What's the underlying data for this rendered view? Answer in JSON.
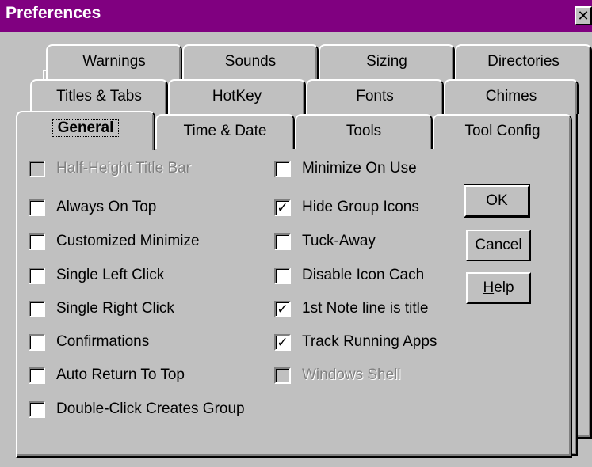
{
  "window": {
    "title": "Preferences",
    "close_glyph": "✕"
  },
  "tabs": {
    "row_back": [
      "Warnings",
      "Sounds",
      "Sizing",
      "Directories"
    ],
    "row_middle": [
      "Titles & Tabs",
      "HotKey",
      "Fonts",
      "Chimes"
    ],
    "row_front": [
      "General",
      "Time & Date",
      "Tools",
      "Tool Config"
    ],
    "active": "General"
  },
  "left_options": [
    {
      "label": "Half-Height Title Bar",
      "checked": false,
      "enabled": false
    },
    {
      "label": "Always On Top",
      "checked": false,
      "enabled": true
    },
    {
      "label": "Customized Minimize",
      "checked": false,
      "enabled": true
    },
    {
      "label": "Single Left Click",
      "checked": false,
      "enabled": true
    },
    {
      "label": "Single Right Click",
      "checked": false,
      "enabled": true
    },
    {
      "label": "Confirmations",
      "checked": false,
      "enabled": true
    },
    {
      "label": "Auto Return To Top",
      "checked": false,
      "enabled": true
    },
    {
      "label": "Double-Click Creates Group",
      "checked": false,
      "enabled": true
    }
  ],
  "right_options": [
    {
      "label": "Minimize On Use",
      "checked": false,
      "enabled": true
    },
    {
      "label": "Hide Group Icons",
      "checked": true,
      "enabled": true
    },
    {
      "label": "Tuck-Away",
      "checked": false,
      "enabled": true
    },
    {
      "label": "Disable Icon Cach",
      "checked": false,
      "enabled": true
    },
    {
      "label": "1st Note line is title",
      "checked": true,
      "enabled": true
    },
    {
      "label": "Track Running Apps",
      "checked": true,
      "enabled": true
    },
    {
      "label": "Windows Shell",
      "checked": false,
      "enabled": false
    }
  ],
  "buttons": {
    "ok": "OK",
    "cancel": "Cancel",
    "help_accel": "H",
    "help_rest": "elp"
  },
  "check_glyph": "✓"
}
